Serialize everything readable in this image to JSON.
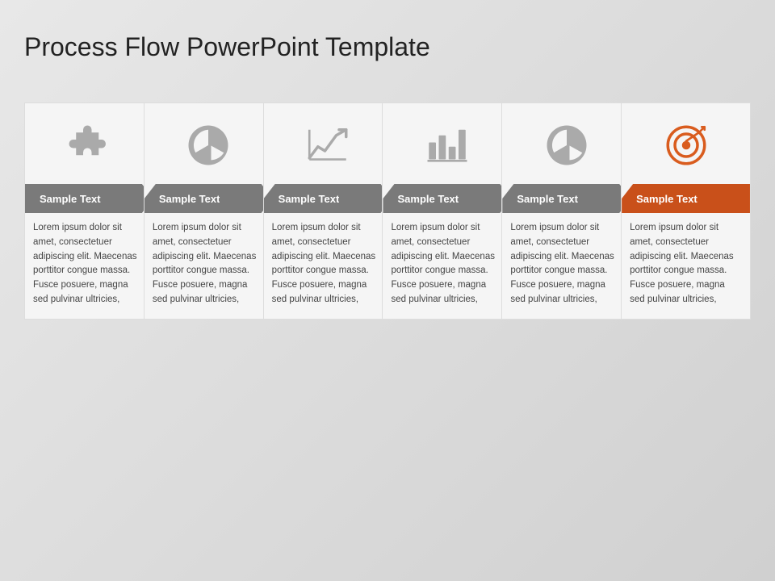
{
  "title": "Process Flow PowerPoint Template",
  "steps": [
    {
      "id": 1,
      "label": "Sample Text",
      "icon": "puzzle",
      "isLast": false,
      "body": "Lorem ipsum dolor sit amet, consectetuer adipiscing elit. Maecenas porttitor congue massa. Fusce posuere, magna sed pulvinar ultricies,"
    },
    {
      "id": 2,
      "label": "Sample Text",
      "icon": "pie",
      "isLast": false,
      "body": "Lorem ipsum dolor sit amet, consectetuer adipiscing elit. Maecenas porttitor congue massa. Fusce posuere, magna sed pulvinar ultricies,"
    },
    {
      "id": 3,
      "label": "Sample Text",
      "icon": "linechart",
      "isLast": false,
      "body": "Lorem ipsum dolor sit amet, consectetuer adipiscing elit. Maecenas porttitor congue massa. Fusce posuere, magna sed pulvinar ultricies,"
    },
    {
      "id": 4,
      "label": "Sample Text",
      "icon": "barchart",
      "isLast": false,
      "body": "Lorem ipsum dolor sit amet, consectetuer adipiscing elit. Maecenas porttitor congue massa. Fusce posuere, magna sed pulvinar ultricies,"
    },
    {
      "id": 5,
      "label": "Sample Text",
      "icon": "pie2",
      "isLast": false,
      "body": "Lorem ipsum dolor sit amet, consectetuer adipiscing elit. Maecenas porttitor congue massa. Fusce posuere, magna sed pulvinar ultricies,"
    },
    {
      "id": 6,
      "label": "Sample Text",
      "icon": "target",
      "isLast": true,
      "body": "Lorem ipsum dolor sit amet, consectetuer adipiscing elit. Maecenas porttitor congue massa. Fusce posuere, magna sed pulvinar ultricies,"
    }
  ]
}
